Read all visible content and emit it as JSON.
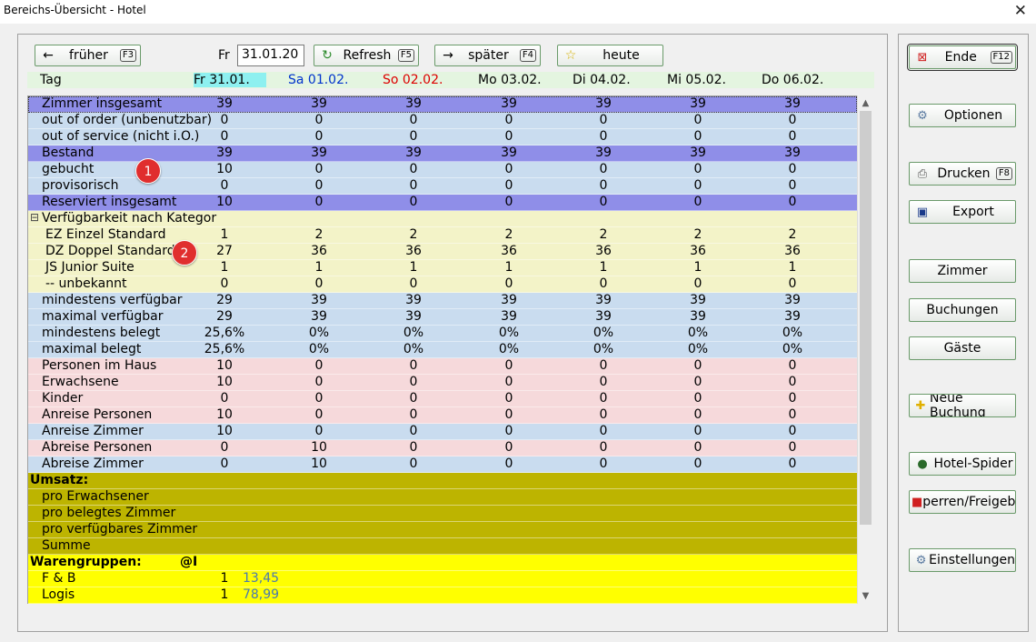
{
  "window": {
    "title": "Bereichs-Übersicht - Hotel",
    "close_icon": "close-icon"
  },
  "toolbar": {
    "frueher_label": "früher",
    "frueher_key": "F3",
    "date_label": "Fr",
    "date_value": "31.01.20",
    "refresh_label": "Refresh",
    "refresh_key": "F5",
    "spaeter_label": "später",
    "spaeter_key": "F4",
    "heute_label": "heute"
  },
  "header": {
    "tag": "Tag",
    "days": [
      "Fr 31.01.",
      "Sa 01.02.",
      "So 02.02.",
      "Mo 03.02.",
      "Di 04.02.",
      "Mi 05.02.",
      "Do 06.02."
    ],
    "colors": {
      "today_bg": "#8ef0f0",
      "saturday": "#0033cc",
      "sunday": "#dd0000"
    }
  },
  "grid": {
    "rows": [
      {
        "label": "Zimmer insgesamt",
        "values": [
          "39",
          "39",
          "39",
          "39",
          "39",
          "39",
          "39"
        ]
      },
      {
        "label": "out of order (unbenutzbar)",
        "values": [
          "0",
          "0",
          "0",
          "0",
          "0",
          "0",
          "0"
        ]
      },
      {
        "label": "out of service (nicht i.O.)",
        "values": [
          "0",
          "0",
          "0",
          "0",
          "0",
          "0",
          "0"
        ]
      },
      {
        "label": "Bestand",
        "values": [
          "39",
          "39",
          "39",
          "39",
          "39",
          "39",
          "39"
        ]
      },
      {
        "label": "gebucht",
        "values": [
          "10",
          "0",
          "0",
          "0",
          "0",
          "0",
          "0"
        ]
      },
      {
        "label": "provisorisch",
        "values": [
          "0",
          "0",
          "0",
          "0",
          "0",
          "0",
          "0"
        ]
      },
      {
        "label": "Reserviert insgesamt",
        "values": [
          "10",
          "0",
          "0",
          "0",
          "0",
          "0",
          "0"
        ]
      },
      {
        "label": "Verfügbarkeit nach Kategor",
        "values": []
      },
      {
        "label": "EZ Einzel Standard",
        "values": [
          "1",
          "2",
          "2",
          "2",
          "2",
          "2",
          "2"
        ]
      },
      {
        "label": "DZ Doppel Standard",
        "values": [
          "27",
          "36",
          "36",
          "36",
          "36",
          "36",
          "36"
        ]
      },
      {
        "label": "JS Junior Suite",
        "values": [
          "1",
          "1",
          "1",
          "1",
          "1",
          "1",
          "1"
        ]
      },
      {
        "label": "-- unbekannt",
        "values": [
          "0",
          "0",
          "0",
          "0",
          "0",
          "0",
          "0"
        ]
      },
      {
        "label": "mindestens verfügbar",
        "values": [
          "29",
          "39",
          "39",
          "39",
          "39",
          "39",
          "39"
        ]
      },
      {
        "label": "maximal verfügbar",
        "values": [
          "29",
          "39",
          "39",
          "39",
          "39",
          "39",
          "39"
        ]
      },
      {
        "label": "mindestens belegt",
        "values": [
          "25,6%",
          "0%",
          "0%",
          "0%",
          "0%",
          "0%",
          "0%"
        ]
      },
      {
        "label": "maximal belegt",
        "values": [
          "25,6%",
          "0%",
          "0%",
          "0%",
          "0%",
          "0%",
          "0%"
        ]
      },
      {
        "label": "Personen im Haus",
        "values": [
          "10",
          "0",
          "0",
          "0",
          "0",
          "0",
          "0"
        ]
      },
      {
        "label": "Erwachsene",
        "values": [
          "10",
          "0",
          "0",
          "0",
          "0",
          "0",
          "0"
        ]
      },
      {
        "label": "Kinder",
        "values": [
          "0",
          "0",
          "0",
          "0",
          "0",
          "0",
          "0"
        ]
      },
      {
        "label": "Anreise Personen",
        "values": [
          "10",
          "0",
          "0",
          "0",
          "0",
          "0",
          "0"
        ]
      },
      {
        "label": "Anreise Zimmer",
        "values": [
          "10",
          "0",
          "0",
          "0",
          "0",
          "0",
          "0"
        ]
      },
      {
        "label": "Abreise Personen",
        "values": [
          "0",
          "10",
          "0",
          "0",
          "0",
          "0",
          "0"
        ]
      },
      {
        "label": "Abreise Zimmer",
        "values": [
          "0",
          "10",
          "0",
          "0",
          "0",
          "0",
          "0"
        ]
      },
      {
        "label": "Umsatz:",
        "values": []
      },
      {
        "label": "pro Erwachsener",
        "values": []
      },
      {
        "label": "pro belegtes Zimmer",
        "values": []
      },
      {
        "label": "pro verfügbares Zimmer",
        "values": []
      },
      {
        "label": "Summe",
        "values": []
      },
      {
        "label": "Warengruppen:",
        "extra": "@I",
        "values": []
      },
      {
        "label": "F & B",
        "qty": "1",
        "amount": "13,45",
        "values": []
      },
      {
        "label": "Logis",
        "qty": "1",
        "amount": "78,99",
        "values": []
      }
    ],
    "amount_color": "#4a7ab0"
  },
  "badges": [
    "1",
    "2"
  ],
  "sidebar": {
    "ende_label": "Ende",
    "ende_key": "F12",
    "optionen_label": "Optionen",
    "drucken_label": "Drucken",
    "drucken_key": "F8",
    "export_label": "Export",
    "zimmer_label": "Zimmer",
    "buchungen_label": "Buchungen",
    "gaeste_label": "Gäste",
    "neue_buchung_label": "Neue Buchung",
    "hotel_spider_label": "Hotel-Spider",
    "sperren_label": "perren/Freigebe",
    "einstellungen_label": "Einstellungen"
  }
}
